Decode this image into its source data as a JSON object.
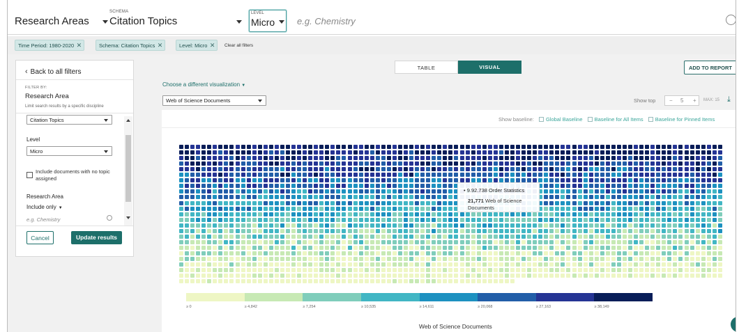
{
  "topbar": {
    "field1": "Research Areas",
    "schema_label": "SCHEMA",
    "schema_value": "Citation Topics",
    "level_label": "LEVEL",
    "level_value": "Micro",
    "search_placeholder": "e.g. Chemistry"
  },
  "chips": [
    {
      "label": "Time Period: 1980-2020"
    },
    {
      "label": "Schema: Citation Topics"
    },
    {
      "label": "Level: Micro"
    }
  ],
  "clear_all": "Clear all filters",
  "panel": {
    "back": "Back to all filters",
    "filter_by": "FILTER BY:",
    "title": "Research Area",
    "subtitle": "Limit search results by a specific discipline",
    "schema_select": "Citation Topics",
    "level_label": "Level",
    "level_select": "Micro",
    "checkbox_label": "Include documents with no topic assigned",
    "ra_label": "Research Area",
    "include_only": "Include only",
    "search_placeholder": "e.g. Chemistry",
    "cancel": "Cancel",
    "update": "Update results"
  },
  "view": {
    "table_tab": "TABLE",
    "visual_tab": "VISUAL",
    "add_report": "ADD TO REPORT",
    "choose_viz": "Choose a different visualization",
    "metric": "Web of Science Documents",
    "show_top_label": "Show top",
    "show_top_value": "5",
    "max_label": "MAX: 15",
    "show_baseline": "Show baseline:",
    "baselines": [
      "Global Baseline",
      "Baseline for All Items",
      "Baseline for Pinned Items"
    ]
  },
  "tooltip": {
    "title": "9.92.738 Order Statistics",
    "value_bold": "21,771",
    "value_text": "Web of Science Documents"
  },
  "chart_data": {
    "type": "heatmap",
    "xlabel": "Web of Science Documents",
    "legend_thresholds": [
      "≥ 0",
      "≥ 4,842",
      "≥ 7,254",
      "≥ 10,535",
      "≥ 14,611",
      "≥ 20,068",
      "≥ 27,163",
      "≥ 38,149"
    ],
    "legend_colors": [
      "#eef6c4",
      "#c7e9b4",
      "#7fcdbb",
      "#41b6c4",
      "#1d91c0",
      "#225ea8",
      "#253494",
      "#081d58"
    ]
  },
  "colors": {
    "accent": "#1d6f6a",
    "chip_bg": "#d2e7e6"
  }
}
